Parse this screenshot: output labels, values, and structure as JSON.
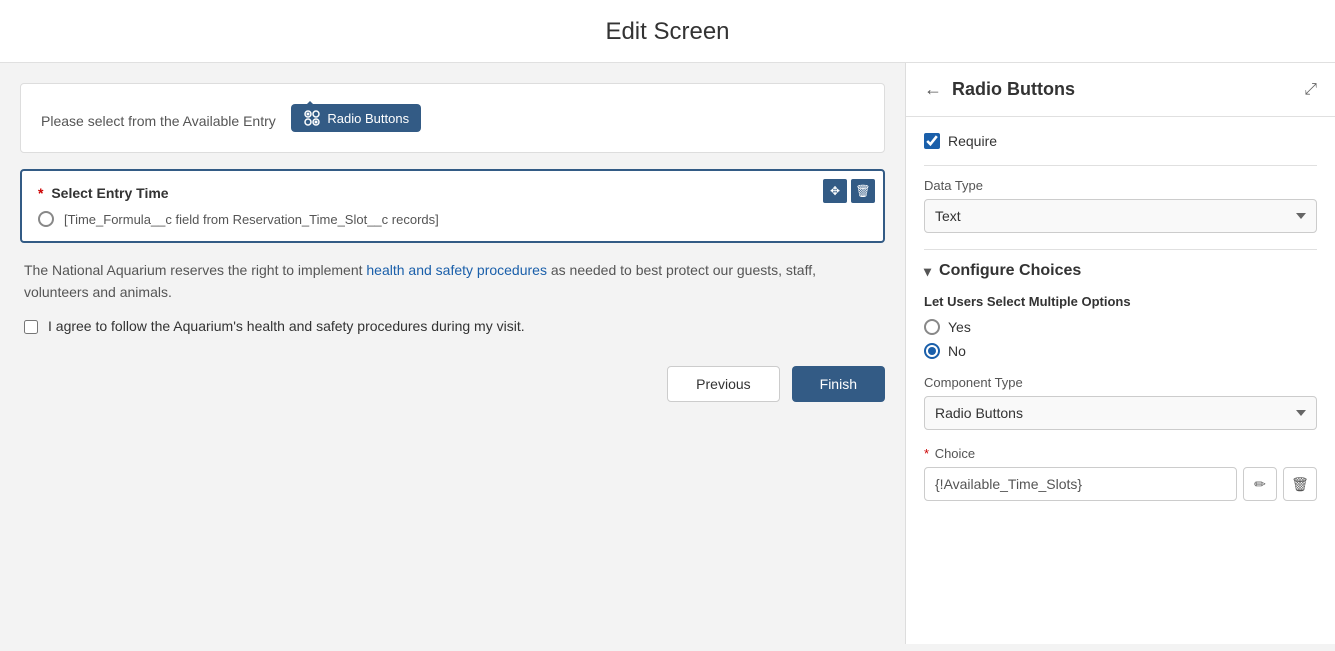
{
  "page": {
    "title": "Edit Screen"
  },
  "left": {
    "entry_prompt": "Please select from the Available Entry  (te}.",
    "tooltip_label": "Radio Buttons",
    "select_time": {
      "required_star": "*",
      "label": "Select Entry Time",
      "radio_value": "[Time_Formula__c field from Reservation_Time_Slot__c records]"
    },
    "info_text_before": "The National Aquarium reserves the right to implement ",
    "info_link": "health and safety procedures",
    "info_text_after": " as needed to best protect our guests, staff, volunteers and animals.",
    "checkbox_label": "I agree to follow the Aquarium's health and safety procedures during my visit.",
    "btn_previous": "Previous",
    "btn_finish": "Finish"
  },
  "right": {
    "panel_title": "Radio Buttons",
    "require_label": "Require",
    "data_type_label": "Data Type",
    "data_type_value": "Text",
    "configure_choices_label": "Configure Choices",
    "multiple_options_label": "Let Users Select Multiple Options",
    "yes_label": "Yes",
    "no_label": "No",
    "component_type_label": "Component Type",
    "component_type_value": "Radio Buttons",
    "choice_label": "Choice",
    "choice_value": "{!Available_Time_Slots}"
  }
}
